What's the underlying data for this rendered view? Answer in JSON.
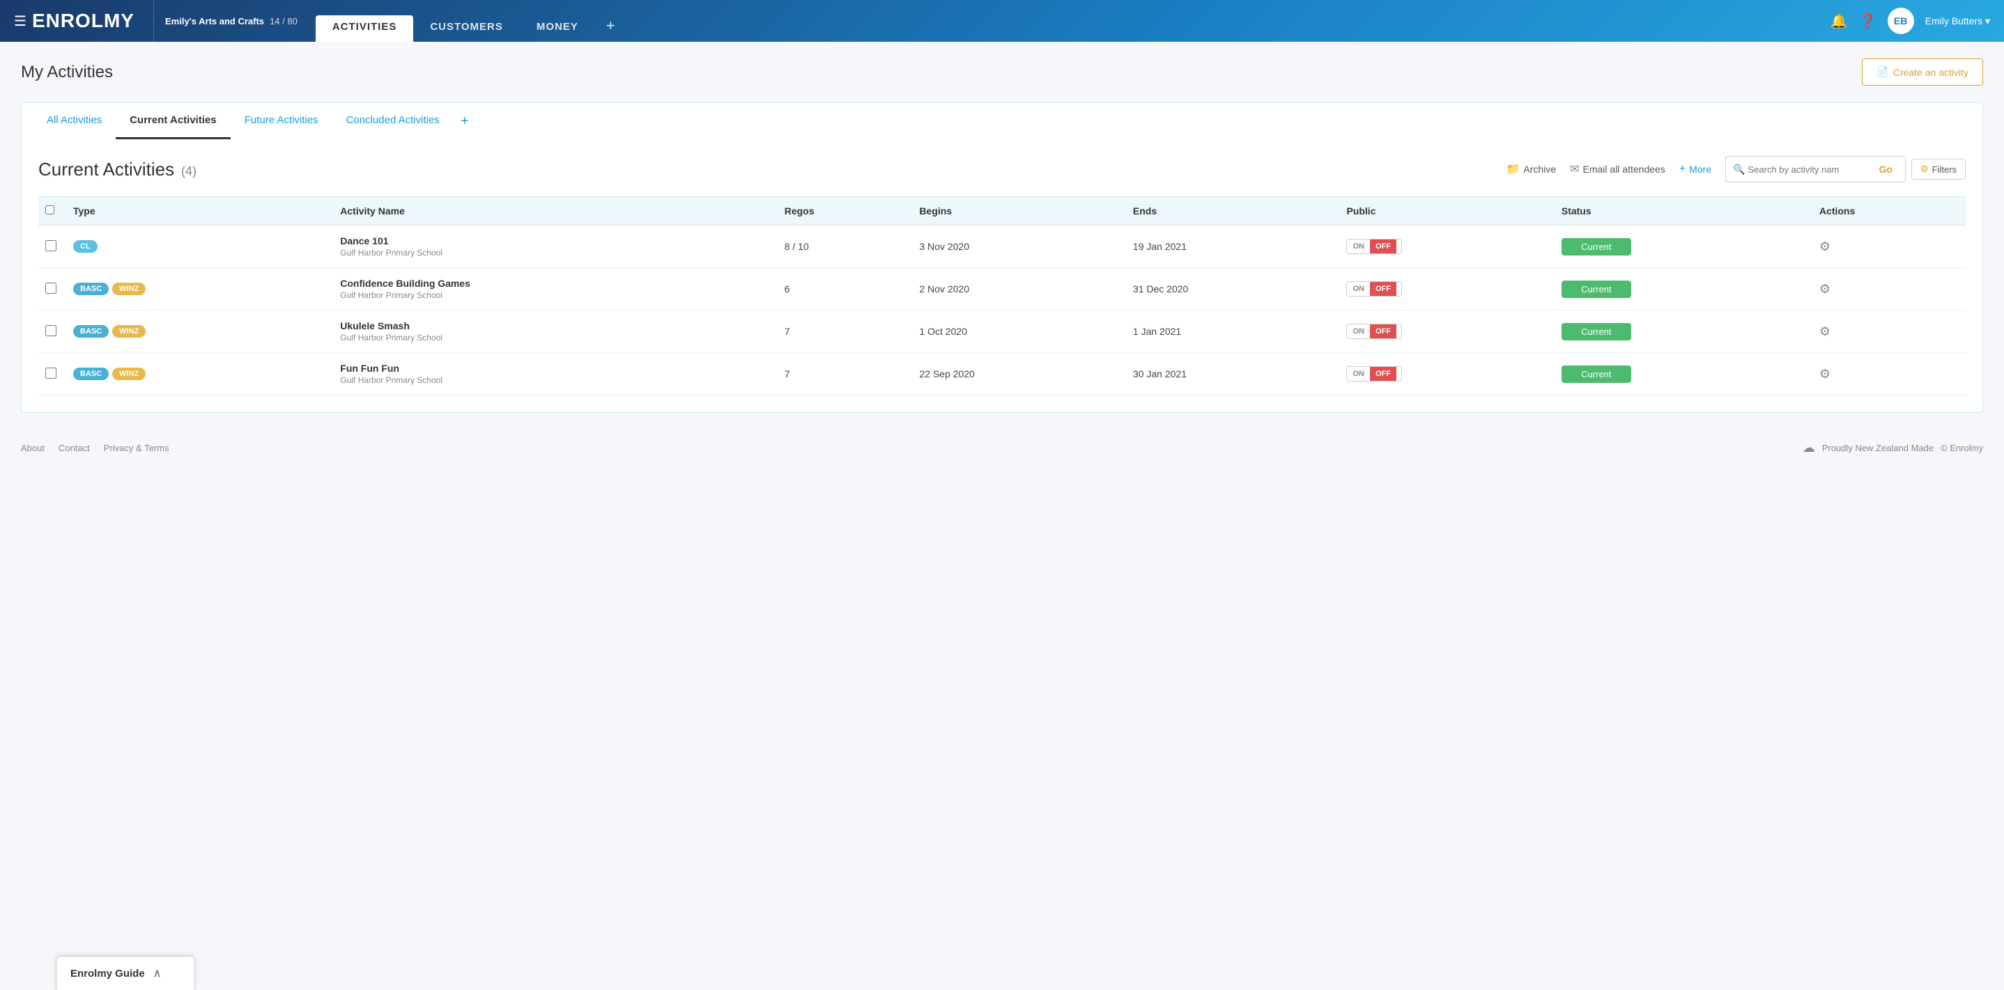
{
  "header": {
    "logo": "ENROLMY",
    "logo_icon": "☰",
    "org_name": "Emily's Arts and Crafts",
    "org_count": "14 / 80",
    "nav_tabs": [
      {
        "id": "activities",
        "label": "ACTIVITIES",
        "active": true
      },
      {
        "id": "customers",
        "label": "CUSTOMERS",
        "active": false
      },
      {
        "id": "money",
        "label": "MONEY",
        "active": false
      }
    ],
    "nav_plus": "+",
    "user_initials": "EB",
    "user_name": "Emily Butters",
    "user_dropdown": "▾"
  },
  "page": {
    "title": "My Activities",
    "create_btn": "Create an activity",
    "create_icon": "📄"
  },
  "activity_tabs": [
    {
      "id": "all",
      "label": "All Activities",
      "active": false,
      "style": "blue"
    },
    {
      "id": "current",
      "label": "Current Activities",
      "active": true,
      "style": "dark"
    },
    {
      "id": "future",
      "label": "Future Activities",
      "active": false,
      "style": "blue"
    },
    {
      "id": "concluded",
      "label": "Concluded Activities",
      "active": false,
      "style": "blue"
    }
  ],
  "activities_section": {
    "title": "Current Activities",
    "count": "(4)",
    "archive_btn": "Archive",
    "email_btn": "Email all attendees",
    "more_btn": "More",
    "search_placeholder": "Search by activity nam",
    "go_btn": "Go",
    "filters_btn": "Filters"
  },
  "table": {
    "headers": [
      "",
      "Type",
      "",
      "Activity Name",
      "Regos",
      "Begins",
      "Ends",
      "Public",
      "Status",
      "Actions"
    ],
    "rows": [
      {
        "id": 1,
        "badges": [
          {
            "label": "CL",
            "style": "cl"
          }
        ],
        "name": "Dance 101",
        "venue": "Gulf Harbor Primary School",
        "regos": "8 / 10",
        "begins": "3 Nov 2020",
        "ends": "19 Jan 2021",
        "public_on": "ON",
        "public_off": "OFF",
        "status": "Current"
      },
      {
        "id": 2,
        "badges": [
          {
            "label": "BASC",
            "style": "basc"
          },
          {
            "label": "WINZ",
            "style": "winz"
          }
        ],
        "name": "Confidence Building Games",
        "venue": "Gulf Harbor Primary School",
        "regos": "6",
        "begins": "2 Nov 2020",
        "ends": "31 Dec 2020",
        "public_on": "ON",
        "public_off": "OFF",
        "status": "Current"
      },
      {
        "id": 3,
        "badges": [
          {
            "label": "BASC",
            "style": "basc"
          },
          {
            "label": "WINZ",
            "style": "winz"
          }
        ],
        "name": "Ukulele Smash",
        "venue": "Gulf Harbor Primary School",
        "regos": "7",
        "begins": "1 Oct 2020",
        "ends": "1 Jan 2021",
        "public_on": "ON",
        "public_off": "OFF",
        "status": "Current"
      },
      {
        "id": 4,
        "badges": [
          {
            "label": "BASC",
            "style": "basc"
          },
          {
            "label": "WINZ",
            "style": "winz"
          }
        ],
        "name": "Fun Fun Fun",
        "venue": "Gulf Harbor Primary School",
        "regos": "7",
        "begins": "22 Sep 2020",
        "ends": "30 Jan 2021",
        "public_on": "ON",
        "public_off": "OFF",
        "status": "Current"
      }
    ]
  },
  "footer": {
    "about": "About",
    "contact": "Contact",
    "privacy": "Privacy & Terms",
    "nz_made": "Proudly New Zealand Made",
    "copyright": "© Enrolmy"
  },
  "guide_widget": {
    "title": "Enrolmy Guide",
    "chevron": "∧"
  }
}
